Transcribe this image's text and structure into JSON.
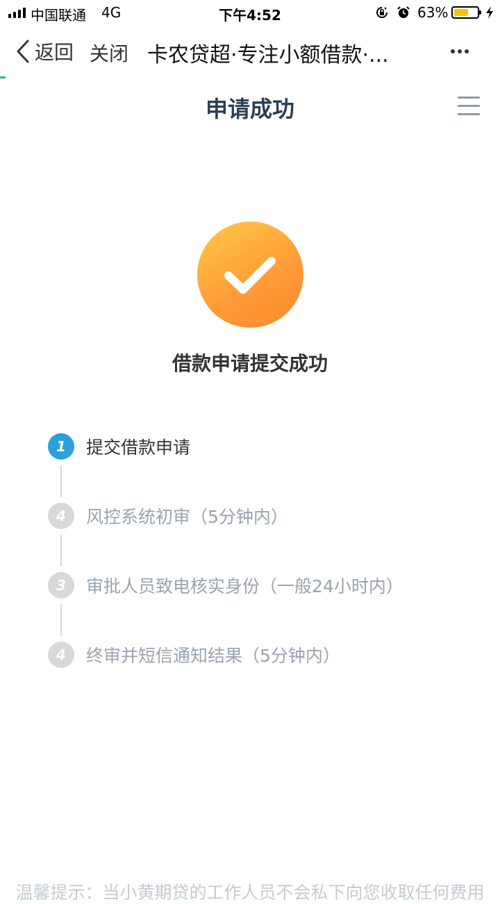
{
  "status_bar": {
    "carrier": "中国联通",
    "network": "4G",
    "time": "下午4:52",
    "battery_percent": "63%",
    "battery_level": 0.63,
    "battery_color": "#f5c400",
    "icons": [
      "signal-icon",
      "rotation-lock-icon",
      "alarm-icon",
      "battery-icon",
      "charging-icon"
    ]
  },
  "nav_bar": {
    "back_label": "返回",
    "close_label": "关闭",
    "title": "卡农贷超·专注小额借款·...",
    "more_icon": "more-dots-icon",
    "accent_color": "#2ab3a6"
  },
  "header": {
    "title": "申请成功",
    "menu_icon": "hamburger-menu-icon"
  },
  "success": {
    "icon": "checkmark-icon",
    "title": "借款申请提交成功",
    "gradient_colors": [
      "#ffc94a",
      "#ff8a2e"
    ]
  },
  "steps": [
    {
      "number": "1",
      "label": "提交借款申请",
      "active": true
    },
    {
      "number": "4",
      "label": "风控系统初审（5分钟内）",
      "active": false
    },
    {
      "number": "3",
      "label": "审批人员致电核实身份（一般24小时内）",
      "active": false
    },
    {
      "number": "4",
      "label": "终审并短信通知结果（5分钟内）",
      "active": false
    }
  ],
  "step_colors": {
    "active": "#2aa0dc",
    "inactive": "#d8d8d8"
  },
  "footer": {
    "tip": "温馨提示：当小黄期贷的工作人员不会私下向您收取任何费用"
  }
}
